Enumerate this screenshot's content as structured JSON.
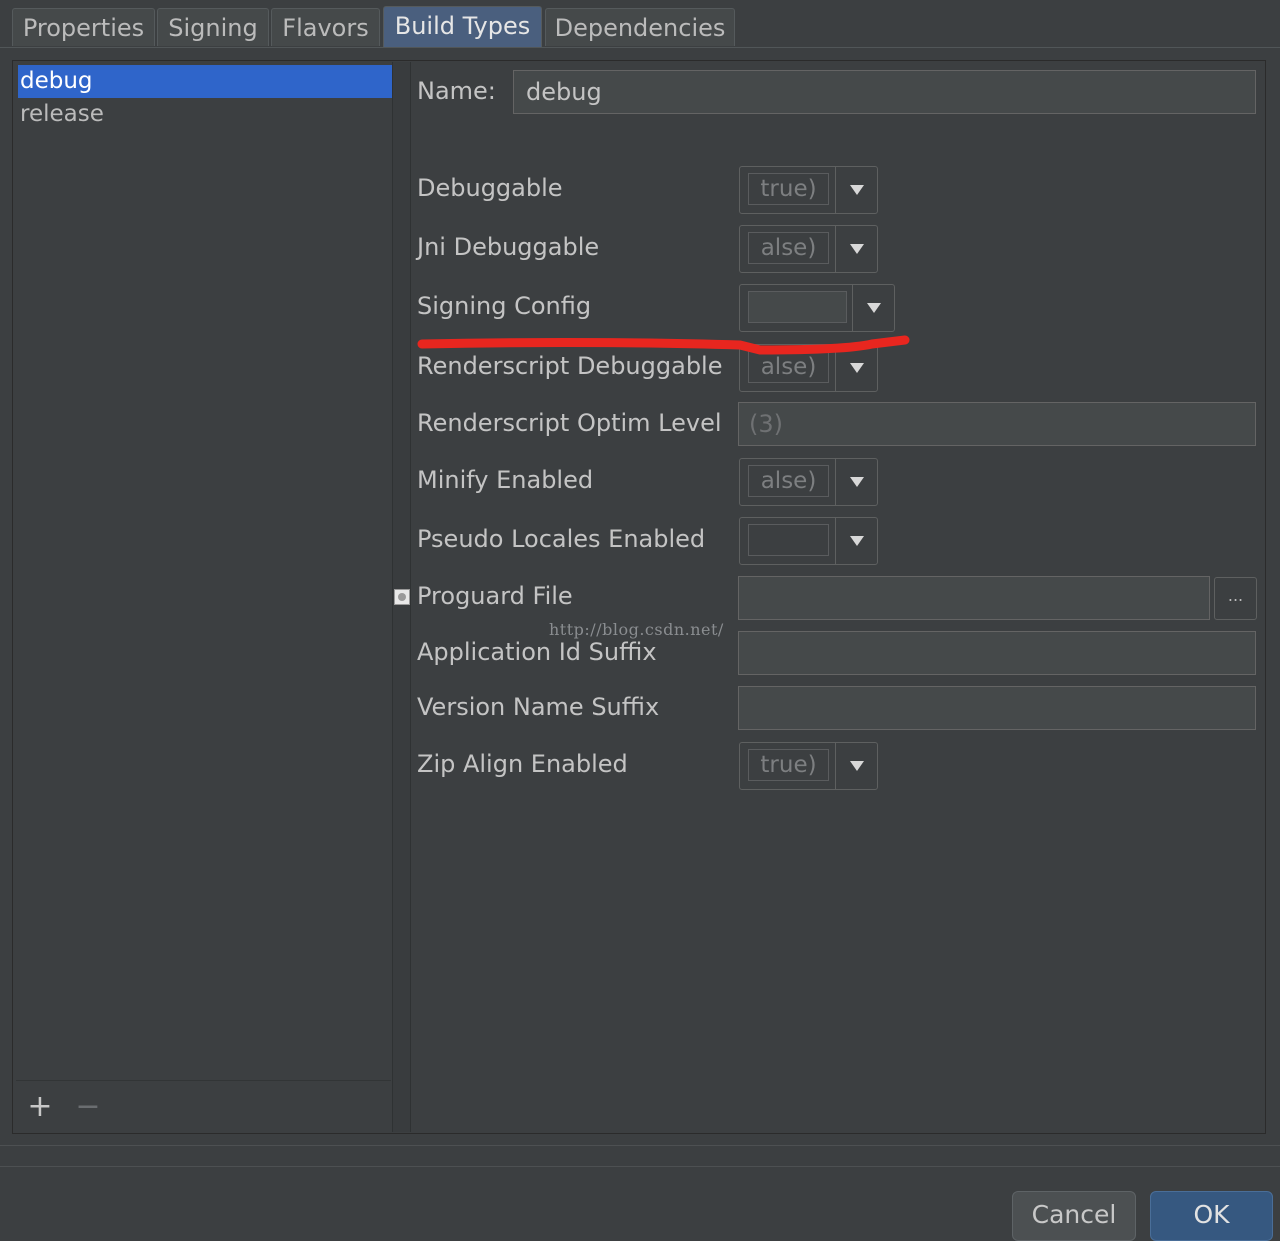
{
  "tabs": [
    {
      "label": "Properties"
    },
    {
      "label": "Signing"
    },
    {
      "label": "Flavors"
    },
    {
      "label": "Build Types",
      "active": true
    },
    {
      "label": "Dependencies"
    }
  ],
  "build_types": {
    "items": [
      {
        "label": "debug",
        "selected": true
      },
      {
        "label": "release"
      }
    ],
    "add_label": "+",
    "remove_label": "−"
  },
  "form": {
    "name_label": "Name:",
    "name_value": "debug",
    "debuggable": {
      "label": "Debuggable",
      "value": "true)"
    },
    "jni_debuggable": {
      "label": "Jni Debuggable",
      "value": "alse)"
    },
    "signing_config": {
      "label": "Signing Config",
      "value": ""
    },
    "renderscript_debuggable": {
      "label": "Renderscript Debuggable",
      "value": "alse)"
    },
    "renderscript_optim_level": {
      "label": "Renderscript Optim Level",
      "value": "(3)"
    },
    "minify_enabled": {
      "label": "Minify Enabled",
      "value": "alse)"
    },
    "pseudo_locales_enabled": {
      "label": "Pseudo Locales Enabled",
      "value": ""
    },
    "proguard_file": {
      "label": "Proguard File",
      "value": "",
      "browse_label": "..."
    },
    "application_id_suffix": {
      "label": "Application Id Suffix",
      "value": ""
    },
    "version_name_suffix": {
      "label": "Version Name Suffix",
      "value": ""
    },
    "zip_align_enabled": {
      "label": "Zip Align Enabled",
      "value": "true)"
    }
  },
  "watermark": "http://blog.csdn.net/",
  "buttons": {
    "cancel": "Cancel",
    "ok": "OK"
  },
  "colors": {
    "selection": "#2f65ca",
    "annotation": "#e8261f",
    "ok_button": "#365880"
  }
}
